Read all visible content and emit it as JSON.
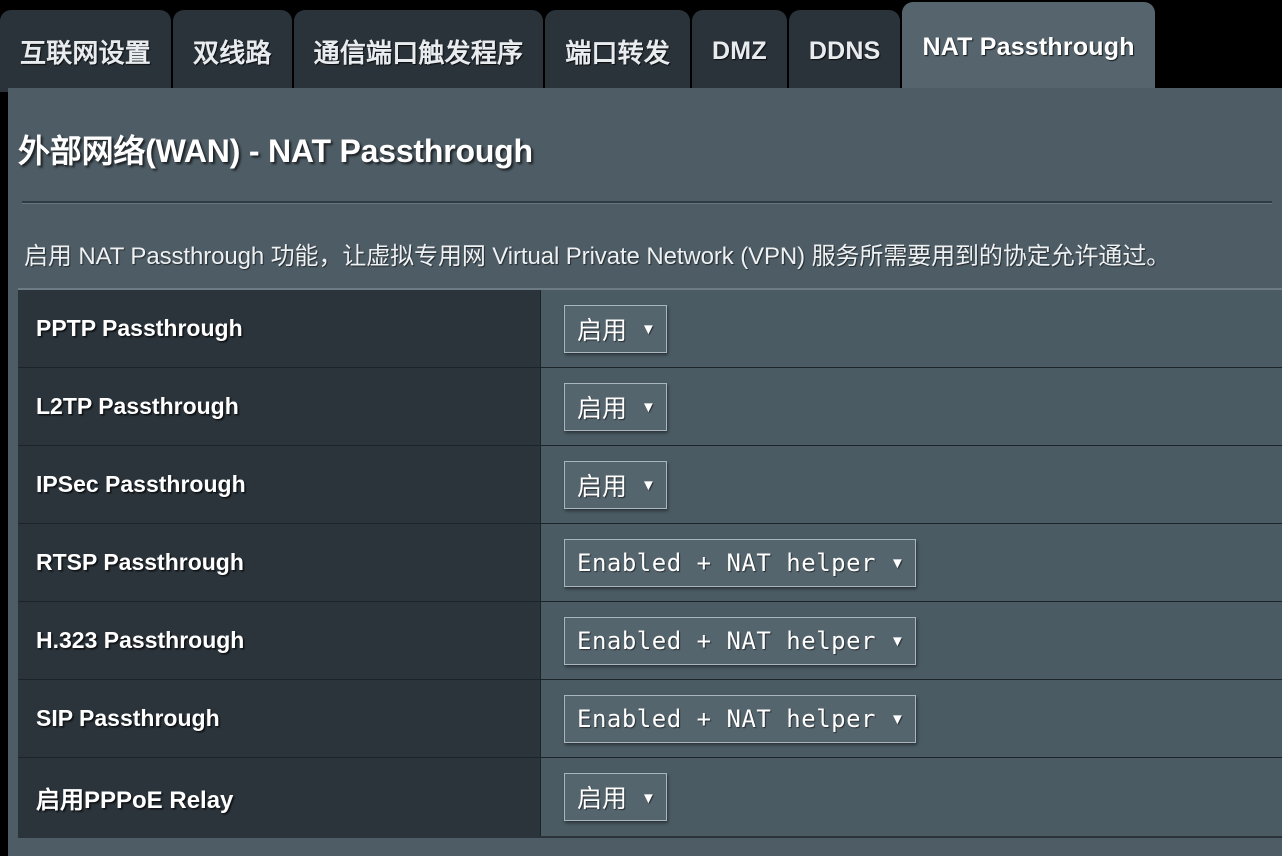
{
  "tabs": [
    {
      "label": "互联网设置",
      "active": false,
      "cjk": true
    },
    {
      "label": "双线路",
      "active": false,
      "cjk": true
    },
    {
      "label": "通信端口触发程序",
      "active": false,
      "cjk": true
    },
    {
      "label": "端口转发",
      "active": false,
      "cjk": true
    },
    {
      "label": "DMZ",
      "active": false,
      "cjk": false
    },
    {
      "label": "DDNS",
      "active": false,
      "cjk": false
    },
    {
      "label": "NAT Passthrough",
      "active": true,
      "cjk": false
    }
  ],
  "page": {
    "title": "外部网络(WAN) - NAT Passthrough",
    "description": "启用 NAT Passthrough 功能，让虚拟专用网 Virtual Private Network (VPN) 服务所需要用到的协定允许通过。"
  },
  "settings": [
    {
      "label": "PPTP Passthrough",
      "value": "启用",
      "caret": "▼",
      "mono": false,
      "cjk_label": false
    },
    {
      "label": "L2TP Passthrough",
      "value": "启用",
      "caret": "▼",
      "mono": false,
      "cjk_label": false
    },
    {
      "label": "IPSec Passthrough",
      "value": "启用",
      "caret": "▼",
      "mono": false,
      "cjk_label": false
    },
    {
      "label": "RTSP Passthrough",
      "value": "Enabled + NAT helper",
      "caret": "▼",
      "mono": true,
      "cjk_label": false
    },
    {
      "label": "H.323 Passthrough",
      "value": "Enabled + NAT helper",
      "caret": "▼",
      "mono": true,
      "cjk_label": false
    },
    {
      "label": "SIP Passthrough",
      "value": "Enabled + NAT helper",
      "caret": "▼",
      "mono": true,
      "cjk_label": false
    },
    {
      "label": "启用PPPoE Relay",
      "value": "启用",
      "caret": "▼",
      "mono": false,
      "cjk_label": true
    }
  ],
  "colors": {
    "page_background": "#000000",
    "panel_background": "#4e5c65",
    "tab_inactive": "#2b333a",
    "tab_active": "#55646d",
    "table_label_background": "#2b343b",
    "table_value_background": "#4b5b64",
    "dropdown_background": "#55656e",
    "dropdown_border": "#aab6bd",
    "text_primary": "#ffffff"
  }
}
